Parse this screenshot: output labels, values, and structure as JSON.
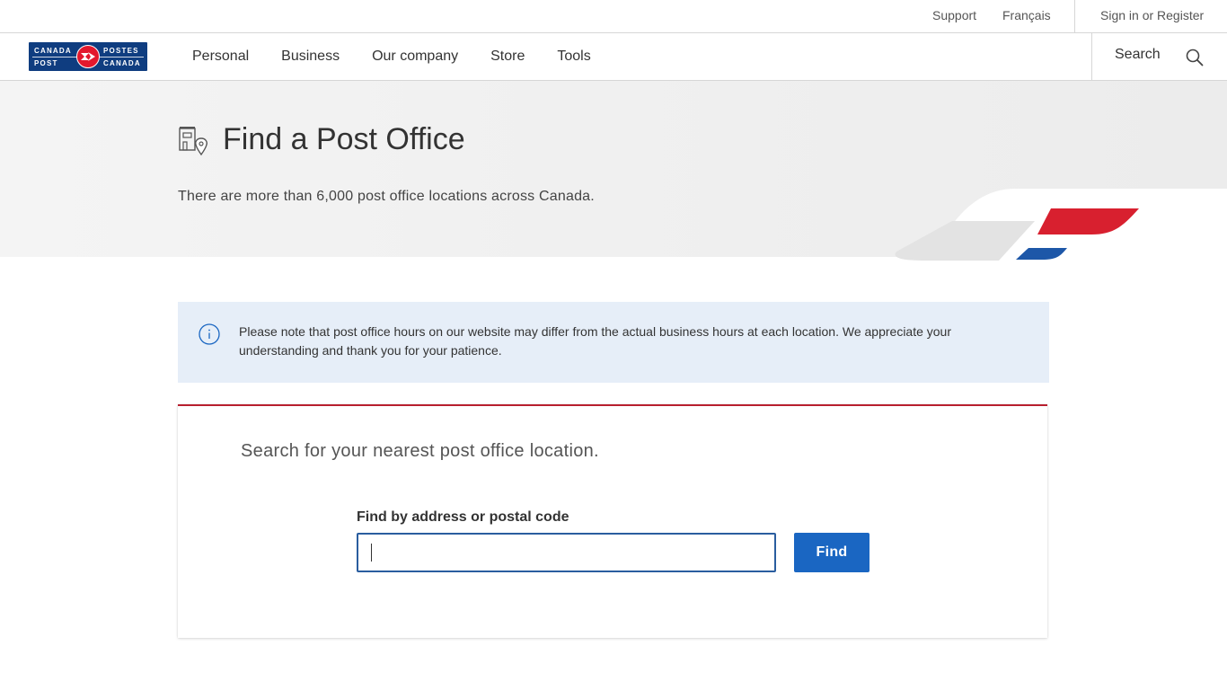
{
  "utility": {
    "support": "Support",
    "francais": "Français",
    "signin": "Sign in or Register"
  },
  "logo": {
    "line1_left": "CANADA",
    "line2_left": "POST",
    "line1_right": "POSTES",
    "line2_right": "CANADA"
  },
  "nav": {
    "items": [
      {
        "label": "Personal"
      },
      {
        "label": "Business"
      },
      {
        "label": "Our company"
      },
      {
        "label": "Store"
      },
      {
        "label": "Tools"
      }
    ],
    "search_label": "Search"
  },
  "hero": {
    "title": "Find a Post Office",
    "subtitle": "There are more than 6,000 post office locations across Canada."
  },
  "notice": {
    "text": "Please note that post office hours on our website may differ from the actual business hours at each location. We appreciate your understanding and thank you for your patience."
  },
  "search_card": {
    "lead": "Search for your nearest post office location.",
    "field_label": "Find by address or postal code",
    "field_value": "",
    "find_button": "Find"
  },
  "colors": {
    "brand_blue": "#0f3d80",
    "brand_red": "#e3182d",
    "button_blue": "#1a66c2",
    "notice_bg": "#e6eef8",
    "card_top_border": "#b8202f"
  }
}
